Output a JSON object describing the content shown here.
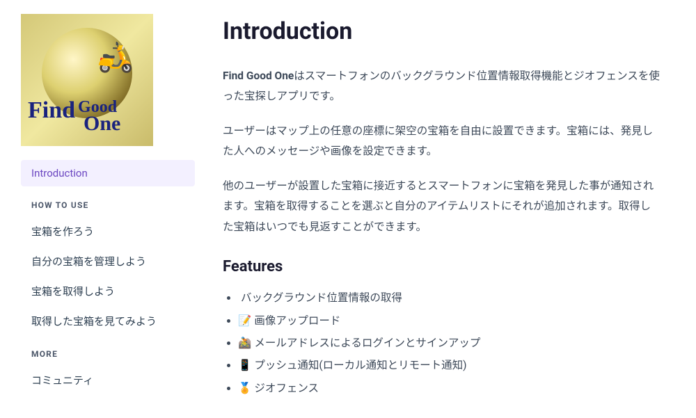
{
  "sidebar": {
    "activeItem": "Introduction",
    "sections": [
      {
        "header": "HOW TO USE",
        "items": [
          "宝箱を作ろう",
          "自分の宝箱を管理しよう",
          "宝箱を取得しよう",
          "取得した宝箱を見てみよう"
        ]
      },
      {
        "header": "MORE",
        "items": [
          "コミュニティ"
        ]
      }
    ]
  },
  "content": {
    "title": "Introduction",
    "intro_bold": "Find Good One",
    "intro_rest": "はスマートフォンのバックグラウンド位置情報取得機能とジオフェンスを使った宝探しアプリです。",
    "para2": "ユーザーはマップ上の任意の座標に架空の宝箱を自由に設置できます。宝箱には、発見した人へのメッセージや画像を設定できます。",
    "para3": "他のユーザーが設置した宝箱に接近するとスマートフォンに宝箱を発見した事が通知されます。宝箱を取得することを選ぶと自分のアイテムリストにそれが追加されます。取得した宝箱はいつでも見返すことができます。",
    "features_heading": "Features",
    "features": [
      {
        "emoji": "",
        "text": "バックグラウンド位置情報の取得"
      },
      {
        "emoji": "📝",
        "text": "画像アップロード"
      },
      {
        "emoji": "🚵",
        "text": "メールアドレスによるログインとサインアップ"
      },
      {
        "emoji": "📱",
        "text": "プッシュ通知(ローカル通知とリモート通知)"
      },
      {
        "emoji": "🏅",
        "text": "ジオフェンス"
      }
    ]
  }
}
